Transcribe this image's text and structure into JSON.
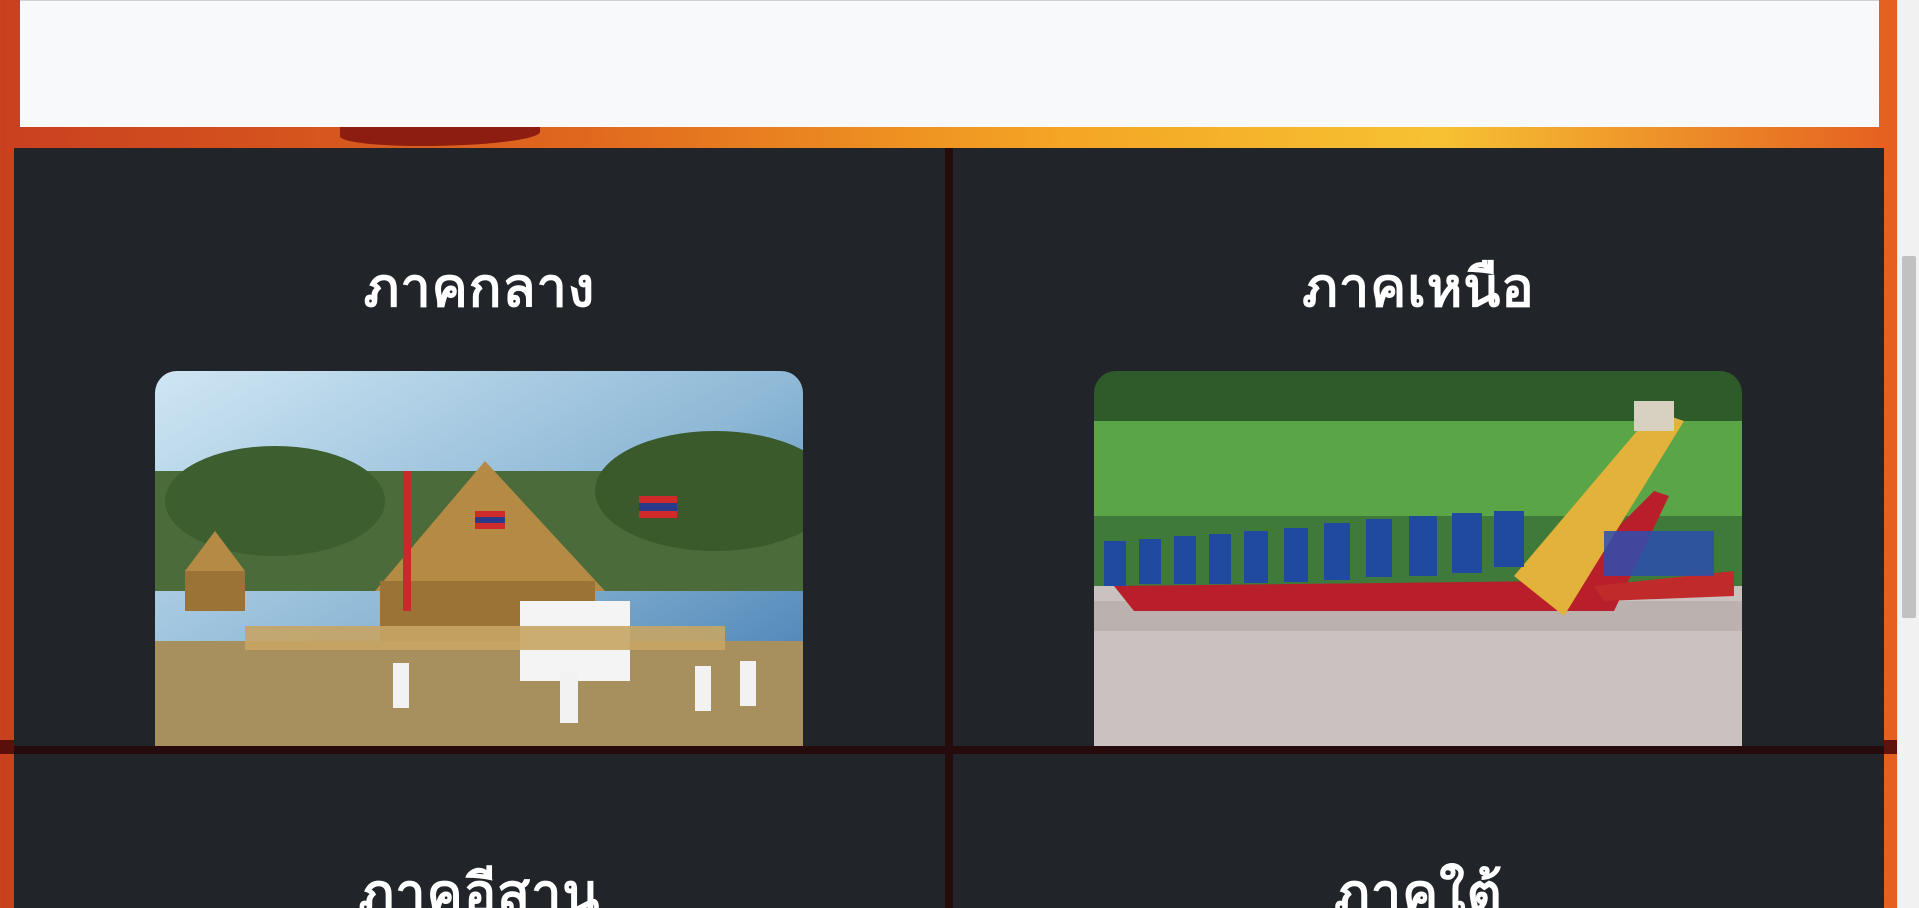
{
  "colors": {
    "card_bg": "#212529",
    "top_panel_bg": "#f8f9fa",
    "title_text": "#ffffff",
    "divider": "#250b0b"
  },
  "regions": [
    {
      "id": "central",
      "title": "ภาคกลาง",
      "image_icon": "straw-temple-ceremony-photo"
    },
    {
      "id": "north",
      "title": "ภาคเหนือ",
      "image_icon": "longboat-race-photo"
    },
    {
      "id": "northeast",
      "title": "ภาคอีสาน"
    },
    {
      "id": "south",
      "title": "ภาคใต้"
    }
  ]
}
